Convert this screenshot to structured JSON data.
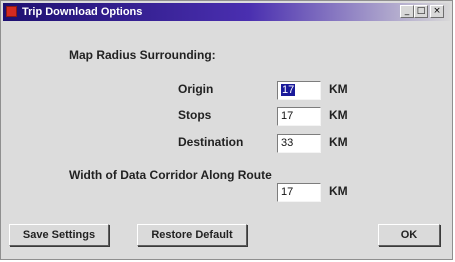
{
  "window": {
    "title": "Trip Download Options"
  },
  "title_controls": {
    "minimize": "_",
    "maximize": "□",
    "close": "×"
  },
  "map_radius": {
    "heading": "Map Radius Surrounding:",
    "rows": [
      {
        "label": "Origin",
        "value": "17",
        "unit": "KM"
      },
      {
        "label": "Stops",
        "value": "17",
        "unit": "KM"
      },
      {
        "label": "Destination",
        "value": "33",
        "unit": "KM"
      }
    ]
  },
  "corridor": {
    "heading": "Width of Data Corridor Along Route",
    "value": "17",
    "unit": "KM"
  },
  "buttons": {
    "save": "Save Settings",
    "restore": "Restore Default",
    "ok": "OK"
  }
}
